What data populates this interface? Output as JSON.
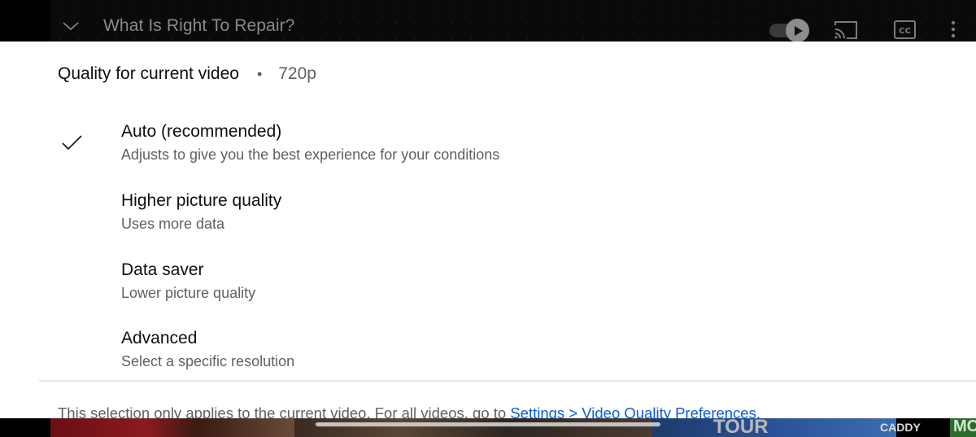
{
  "player": {
    "title": "What Is Right To Repair?",
    "icons": {
      "collapse": "chevron-down-icon",
      "autoplay": "autoplay-toggle-icon",
      "cast": "cast-icon",
      "captions": "closed-captions-icon",
      "more": "more-vert-icon"
    },
    "autoplay_on": true
  },
  "quality_sheet": {
    "header_label": "Quality for current video",
    "separator": "•",
    "current_quality": "720p",
    "options": [
      {
        "title": "Auto (recommended)",
        "subtitle": "Adjusts to give you the best experience for your conditions",
        "selected": true
      },
      {
        "title": "Higher picture quality",
        "subtitle": "Uses more data",
        "selected": false
      },
      {
        "title": "Data saver",
        "subtitle": "Lower picture quality",
        "selected": false
      },
      {
        "title": "Advanced",
        "subtitle": "Select a specific resolution",
        "selected": false
      }
    ],
    "footer_text": "This selection only applies to the current video. For all videos, go to ",
    "footer_link": "Settings > Video Quality Preferences",
    "footer_end": "."
  },
  "thumbnails": {
    "labels": [
      "TOUR",
      "CADDY",
      "MC"
    ]
  },
  "colors": {
    "link": "#065fd4",
    "primary_text": "#0f0f0f",
    "secondary_text": "#606060"
  }
}
